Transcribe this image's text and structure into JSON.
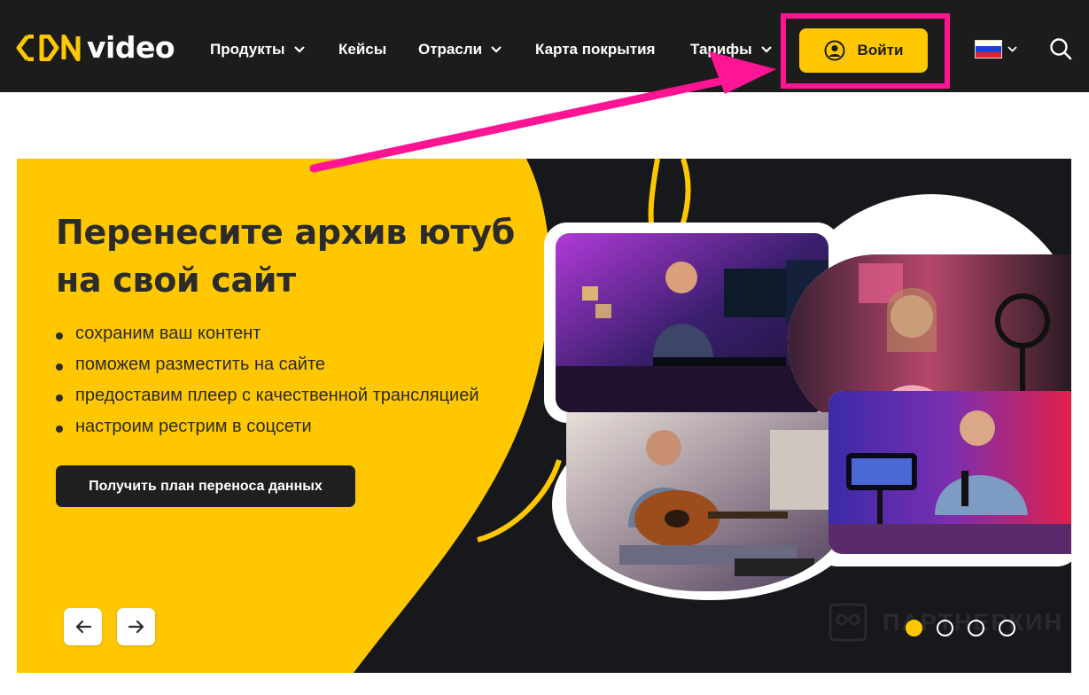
{
  "header": {
    "logo_text": "video",
    "nav": [
      {
        "label": "Продукты",
        "has_dropdown": true
      },
      {
        "label": "Кейсы",
        "has_dropdown": false
      },
      {
        "label": "Отрасли",
        "has_dropdown": true
      },
      {
        "label": "Карта покрытия",
        "has_dropdown": false
      },
      {
        "label": "Тарифы",
        "has_dropdown": true
      }
    ],
    "login_label": "Войти",
    "language": "ru",
    "icons": [
      "user-icon",
      "search-icon",
      "chevron-down-icon",
      "flag-ru-icon"
    ]
  },
  "banner": {
    "headline": "Перенесите архив ютуб на свой сайт",
    "features": [
      "сохраним ваш контент",
      "поможем разместить на сайте",
      "предоставим плеер с качественной трансляцией",
      "настроим рестрим в соцсети"
    ],
    "cta_label": "Получить план переноса данных",
    "watermark": "ПАРТНЕРКИН",
    "slides_total": 4,
    "active_slide": 1,
    "photos": [
      {
        "alt": "gamer-at-desk-photo"
      },
      {
        "alt": "girl-streaming-photo"
      },
      {
        "alt": "guitarist-photo"
      },
      {
        "alt": "man-recording-photo"
      }
    ]
  },
  "colors": {
    "brand_yellow": "#ffc700",
    "header_bg": "#1c1c1c",
    "banner_dark": "#16181c",
    "highlight_pink": "#ff1493"
  }
}
